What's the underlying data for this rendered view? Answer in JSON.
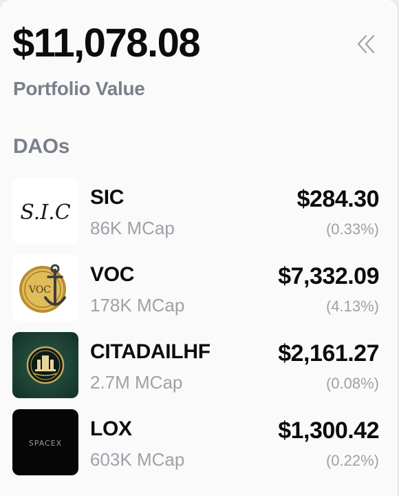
{
  "portfolio": {
    "total_value": "$11,078.08",
    "label": "Portfolio Value",
    "collapse_icon": "double-chevron-left-icon"
  },
  "daos_section": {
    "title": "DAOs",
    "items": [
      {
        "name": "SIC",
        "mcap": "86K MCap",
        "value": "$284.30",
        "percent": "(0.33%)",
        "logo_text": "S.I.C"
      },
      {
        "name": "VOC",
        "mcap": "178K MCap",
        "value": "$7,332.09",
        "percent": "(4.13%)",
        "logo_text": "VOC"
      },
      {
        "name": "CITADAILHF",
        "mcap": "2.7M MCap",
        "value": "$2,161.27",
        "percent": "(0.08%)",
        "logo_text": ""
      },
      {
        "name": "LOX",
        "mcap": "603K MCap",
        "value": "$1,300.42",
        "percent": "(0.22%)",
        "logo_text": "SPACEX"
      }
    ]
  },
  "colors": {
    "primary_text": "#0c0c0c",
    "secondary_text": "#7a7f8a",
    "muted_text": "#9ea1a8",
    "background": "#fafafb"
  }
}
